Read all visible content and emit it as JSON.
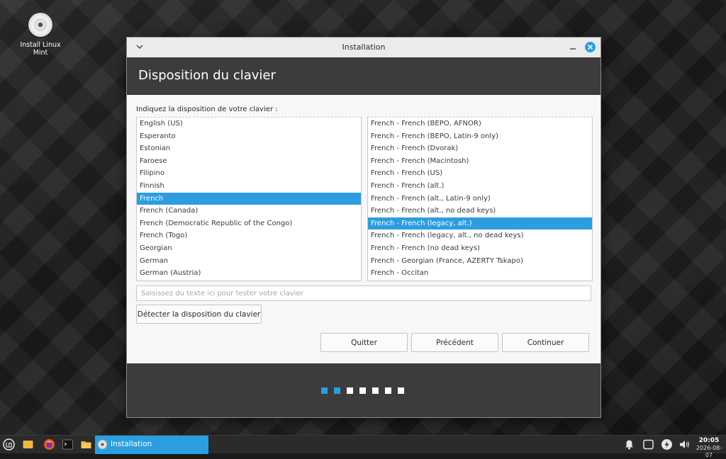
{
  "desktop": {
    "icon_label": "Install Linux Mint"
  },
  "window": {
    "title": "Installation",
    "header_title": "Disposition du clavier",
    "prompt": "Indiquez la disposition de votre clavier :",
    "layouts": [
      {
        "label": "English (US)",
        "selected": false
      },
      {
        "label": "Esperanto",
        "selected": false
      },
      {
        "label": "Estonian",
        "selected": false
      },
      {
        "label": "Faroese",
        "selected": false
      },
      {
        "label": "Filipino",
        "selected": false
      },
      {
        "label": "Finnish",
        "selected": false
      },
      {
        "label": "French",
        "selected": true
      },
      {
        "label": "French (Canada)",
        "selected": false
      },
      {
        "label": "French (Democratic Republic of the Congo)",
        "selected": false
      },
      {
        "label": "French (Togo)",
        "selected": false
      },
      {
        "label": "Georgian",
        "selected": false
      },
      {
        "label": "German",
        "selected": false
      },
      {
        "label": "German (Austria)",
        "selected": false
      }
    ],
    "variants": [
      {
        "label": "French - French (BEPO, AFNOR)",
        "selected": false
      },
      {
        "label": "French - French (BEPO, Latin-9 only)",
        "selected": false
      },
      {
        "label": "French - French (Dvorak)",
        "selected": false
      },
      {
        "label": "French - French (Macintosh)",
        "selected": false
      },
      {
        "label": "French - French (US)",
        "selected": false
      },
      {
        "label": "French - French (alt.)",
        "selected": false
      },
      {
        "label": "French - French (alt., Latin-9 only)",
        "selected": false
      },
      {
        "label": "French - French (alt., no dead keys)",
        "selected": false
      },
      {
        "label": "French - French (legacy, alt.)",
        "selected": true
      },
      {
        "label": "French - French (legacy, alt., no dead keys)",
        "selected": false
      },
      {
        "label": "French - French (no dead keys)",
        "selected": false
      },
      {
        "label": "French - Georgian (France, AZERTY Tskapo)",
        "selected": false
      },
      {
        "label": "French - Occitan",
        "selected": false
      }
    ],
    "test_placeholder": "Saisissez du texte ici pour tester votre clavier",
    "test_value": "",
    "detect_button": "Détecter la disposition du clavier",
    "quit_button": "Quitter",
    "previous_button": "Précédent",
    "continue_button": "Continuer",
    "progress": {
      "total_steps": 7,
      "completed_steps": 2
    }
  },
  "taskbar": {
    "active_task": "Installation",
    "time": "20:05",
    "date": "2026-08-07"
  },
  "colors": {
    "accent": "#2c9ee0",
    "header_bg": "#3c3c3c",
    "taskbar_bg": "#2b2b2b"
  }
}
